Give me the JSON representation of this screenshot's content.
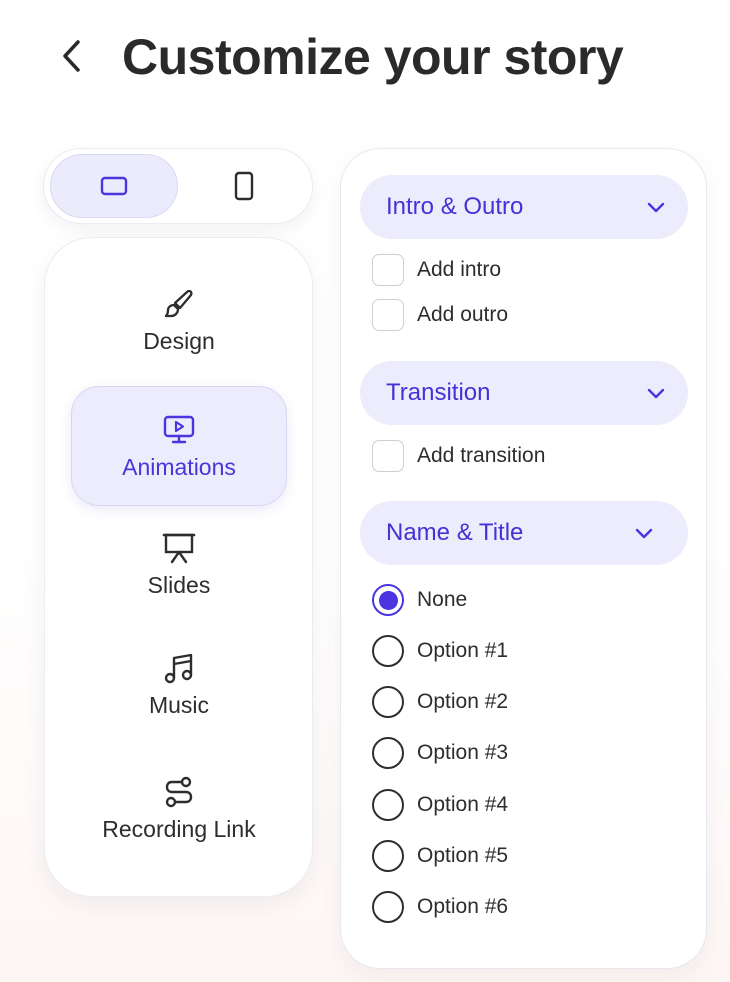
{
  "header": {
    "title": "Customize your story",
    "back_icon": "chevron-left-icon"
  },
  "device_toggle": {
    "options": [
      {
        "id": "landscape",
        "icon": "landscape-screen-icon",
        "selected": true
      },
      {
        "id": "portrait",
        "icon": "portrait-phone-icon",
        "selected": false
      }
    ]
  },
  "nav": {
    "items": [
      {
        "label": "Design",
        "icon": "paintbrush-icon",
        "active": false
      },
      {
        "label": "Animations",
        "icon": "monitor-play-icon",
        "active": true
      },
      {
        "label": "Slides",
        "icon": "presentation-icon",
        "active": false
      },
      {
        "label": "Music",
        "icon": "music-note-icon",
        "active": false
      },
      {
        "label": "Recording Link",
        "icon": "route-link-icon",
        "active": false
      }
    ]
  },
  "options": {
    "intro_outro": {
      "title": "Intro & Outro",
      "items": [
        {
          "label": "Add intro",
          "checked": false
        },
        {
          "label": "Add outro",
          "checked": false
        }
      ]
    },
    "transition": {
      "title": "Transition",
      "items": [
        {
          "label": "Add transition",
          "checked": false
        }
      ]
    },
    "name_title": {
      "title": "Name & Title",
      "choices": [
        {
          "label": "None",
          "selected": true
        },
        {
          "label": "Option #1",
          "selected": false
        },
        {
          "label": "Option #2",
          "selected": false
        },
        {
          "label": "Option #3",
          "selected": false
        },
        {
          "label": "Option #4",
          "selected": false
        },
        {
          "label": "Option #5",
          "selected": false
        },
        {
          "label": "Option #6",
          "selected": false
        }
      ]
    }
  },
  "colors": {
    "accent": "#4a35e0",
    "accent_bg": "#ececfc",
    "text": "#2d2d2d"
  }
}
